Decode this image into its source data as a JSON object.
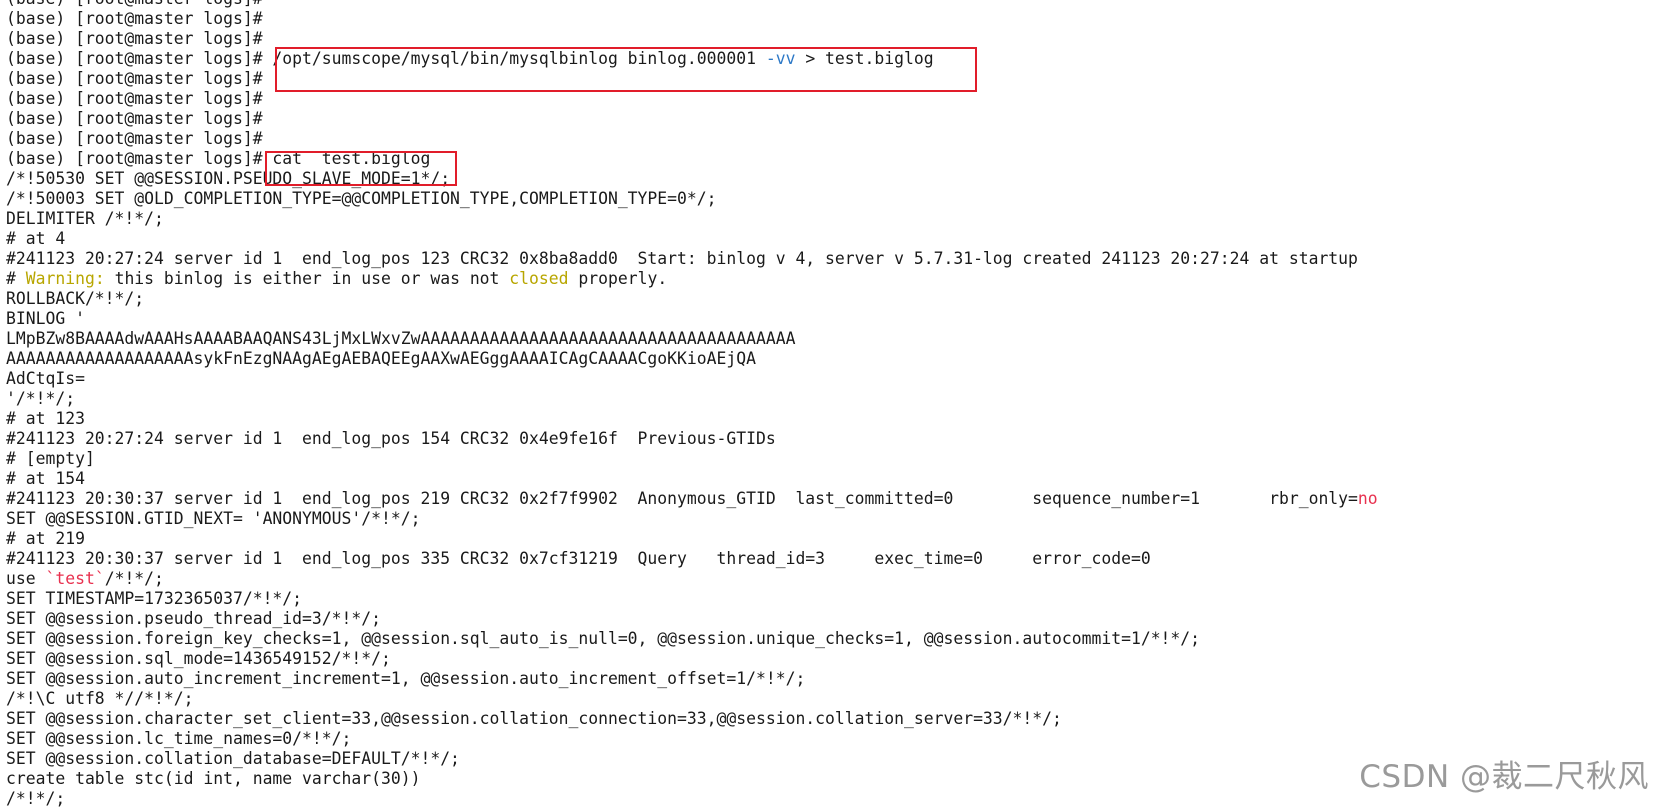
{
  "terminal": {
    "lines": [
      [
        {
          "t": "(base) [root@master logs]#"
        }
      ],
      [
        {
          "t": "(base) [root@master logs]#"
        }
      ],
      [
        {
          "t": "(base) [root@master logs]#"
        }
      ],
      [
        {
          "t": "(base) [root@master logs]# /opt/sumscope/mysql/bin/mysqlbinlog binlog.000001 "
        },
        {
          "t": "-vv",
          "c": "blue"
        },
        {
          "t": " > test.biglog"
        }
      ],
      [
        {
          "t": "(base) [root@master logs]#"
        }
      ],
      [
        {
          "t": "(base) [root@master logs]#"
        }
      ],
      [
        {
          "t": "(base) [root@master logs]#"
        }
      ],
      [
        {
          "t": "(base) [root@master logs]#"
        }
      ],
      [
        {
          "t": "(base) [root@master logs]# cat  test.biglog"
        }
      ],
      [
        {
          "t": "/*!50530 SET @@SESSION.PSEUDO_SLAVE_MODE=1*/;"
        }
      ],
      [
        {
          "t": "/*!50003 SET @OLD_COMPLETION_TYPE=@@COMPLETION_TYPE,COMPLETION_TYPE=0*/;"
        }
      ],
      [
        {
          "t": "DELIMITER /*!*/;"
        }
      ],
      [
        {
          "t": "# at 4"
        }
      ],
      [
        {
          "t": "#241123 20:27:24 server id 1  end_log_pos 123 CRC32 0x8ba8add0  Start: binlog v 4, server v 5.7.31-log created 241123 20:27:24 at startup"
        }
      ],
      [
        {
          "t": "# "
        },
        {
          "t": "Warning:",
          "c": "yellow"
        },
        {
          "t": " this binlog is either in use or was not "
        },
        {
          "t": "closed",
          "c": "yellow"
        },
        {
          "t": " properly."
        }
      ],
      [
        {
          "t": "ROLLBACK/*!*/;"
        }
      ],
      [
        {
          "t": "BINLOG '"
        }
      ],
      [
        {
          "t": "LMpBZw8BAAAAdwAAAHsAAAABAAQANS43LjMxLWxvZwAAAAAAAAAAAAAAAAAAAAAAAAAAAAAAAAAAAAAA"
        }
      ],
      [
        {
          "t": "AAAAAAAAAAAAAAAAAAAsykFnEzgNAAgAEgAEBAQEEgAAXwAEGggAAAAICAgCAAAACgoKKioAEjQA"
        }
      ],
      [
        {
          "t": "AdCtqIs="
        }
      ],
      [
        {
          "t": "'/*!*/;"
        }
      ],
      [
        {
          "t": "# at 123"
        }
      ],
      [
        {
          "t": "#241123 20:27:24 server id 1  end_log_pos 154 CRC32 0x4e9fe16f  Previous-GTIDs"
        }
      ],
      [
        {
          "t": "# [empty]"
        }
      ],
      [
        {
          "t": "# at 154"
        }
      ],
      [
        {
          "t": "#241123 20:30:37 server id 1  end_log_pos 219 CRC32 0x2f7f9902  Anonymous_GTID  last_committed=0        sequence_number=1       rbr_only="
        },
        {
          "t": "no",
          "c": "red"
        }
      ],
      [
        {
          "t": "SET @@SESSION.GTID_NEXT= 'ANONYMOUS'/*!*/;"
        }
      ],
      [
        {
          "t": "# at 219"
        }
      ],
      [
        {
          "t": "#241123 20:30:37 server id 1  end_log_pos 335 CRC32 0x7cf31219  Query   thread_id=3     exec_time=0     error_code=0"
        }
      ],
      [
        {
          "t": "use "
        },
        {
          "t": "`test`",
          "c": "red"
        },
        {
          "t": "/*!*/;"
        }
      ],
      [
        {
          "t": "SET TIMESTAMP=1732365037/*!*/;"
        }
      ],
      [
        {
          "t": "SET @@session.pseudo_thread_id=3/*!*/;"
        }
      ],
      [
        {
          "t": "SET @@session.foreign_key_checks=1, @@session.sql_auto_is_null=0, @@session.unique_checks=1, @@session.autocommit=1/*!*/;"
        }
      ],
      [
        {
          "t": "SET @@session.sql_mode=1436549152/*!*/;"
        }
      ],
      [
        {
          "t": "SET @@session.auto_increment_increment=1, @@session.auto_increment_offset=1/*!*/;"
        }
      ],
      [
        {
          "t": "/*!\\C utf8 *//*!*/;"
        }
      ],
      [
        {
          "t": "SET @@session.character_set_client=33,@@session.collation_connection=33,@@session.collation_server=33/*!*/;"
        }
      ],
      [
        {
          "t": "SET @@session.lc_time_names=0/*!*/;"
        }
      ],
      [
        {
          "t": "SET @@session.collation_database=DEFAULT/*!*/;"
        }
      ],
      [
        {
          "t": "create table stc(id int, name varchar(30))"
        }
      ],
      [
        {
          "t": "/*!*/;"
        }
      ]
    ]
  },
  "watermark": {
    "text": "CSDN @裁二尺秋风"
  },
  "colors": {
    "background": "#ffffff",
    "text": "#1a1a1a",
    "highlight_box": "#e11d2a",
    "yellow": "#b8a600",
    "red": "#e8314f",
    "blue": "#2d79c7"
  }
}
